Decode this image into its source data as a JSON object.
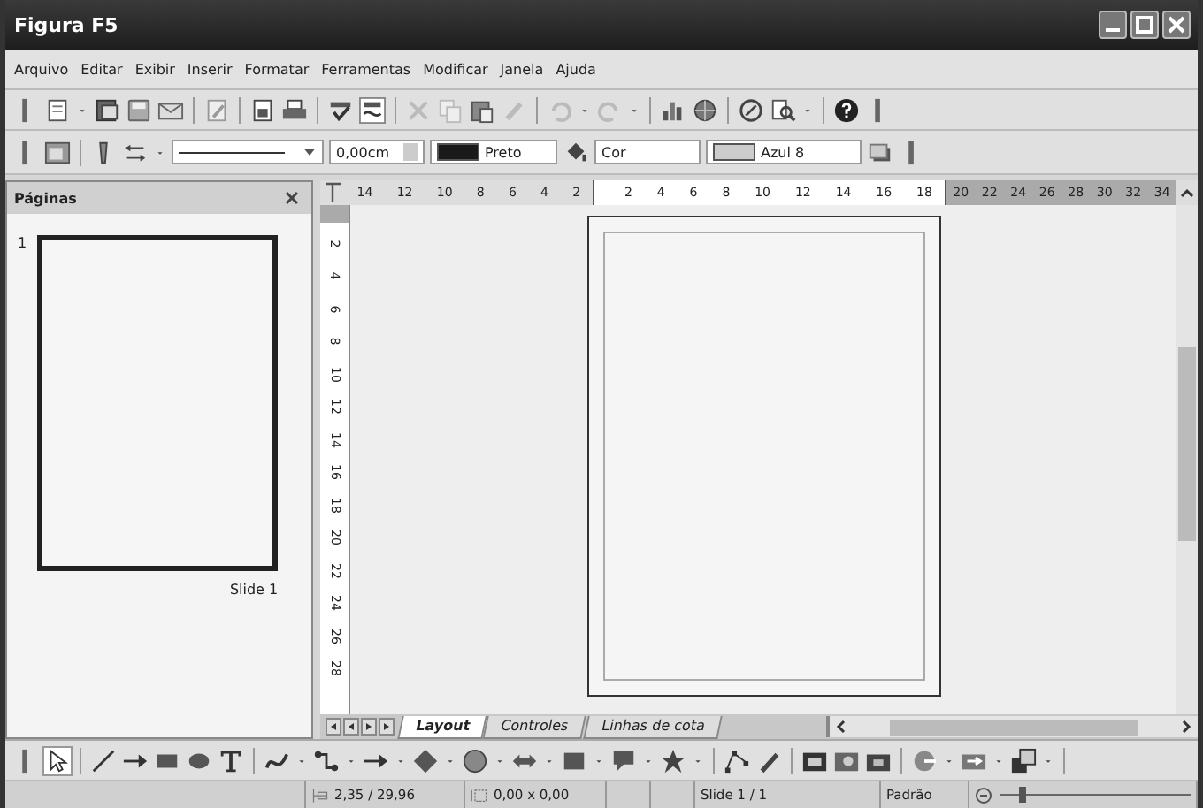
{
  "window": {
    "title": "Figura F5"
  },
  "menu": [
    "Arquivo",
    "Editar",
    "Exibir",
    "Inserir",
    "Formatar",
    "Ferramentas",
    "Modificar",
    "Janela",
    "Ajuda"
  ],
  "line_toolbar": {
    "line_width": "0,00cm",
    "line_color": "Preto",
    "area_style": "Cor",
    "area_color": "Azul 8"
  },
  "pages_panel": {
    "title": "Páginas",
    "slides": [
      {
        "number": "1",
        "name": "Slide 1",
        "selected": true
      }
    ]
  },
  "horizontal_ruler": {
    "before_page": [
      "14",
      "12",
      "10",
      "8",
      "6",
      "4",
      "2"
    ],
    "on_page": [
      "2",
      "4",
      "6",
      "8",
      "10",
      "12",
      "14",
      "16",
      "18"
    ],
    "after_page": [
      "20",
      "22",
      "24",
      "26",
      "28",
      "30",
      "32",
      "34"
    ]
  },
  "vertical_ruler": [
    "2",
    "4",
    "6",
    "8",
    "10",
    "12",
    "14",
    "16",
    "18",
    "20",
    "22",
    "24",
    "26",
    "28"
  ],
  "layer_tabs": [
    {
      "label": "Layout",
      "selected": true
    },
    {
      "label": "Controles",
      "selected": false
    },
    {
      "label": "Linhas de cota",
      "selected": false
    }
  ],
  "status_bar": {
    "position": "2,35 / 29,96",
    "size": "0,00 x 0,00",
    "slide": "Slide 1 / 1",
    "layout": "Padrão",
    "zoom": {
      "level": 0.12
    }
  }
}
